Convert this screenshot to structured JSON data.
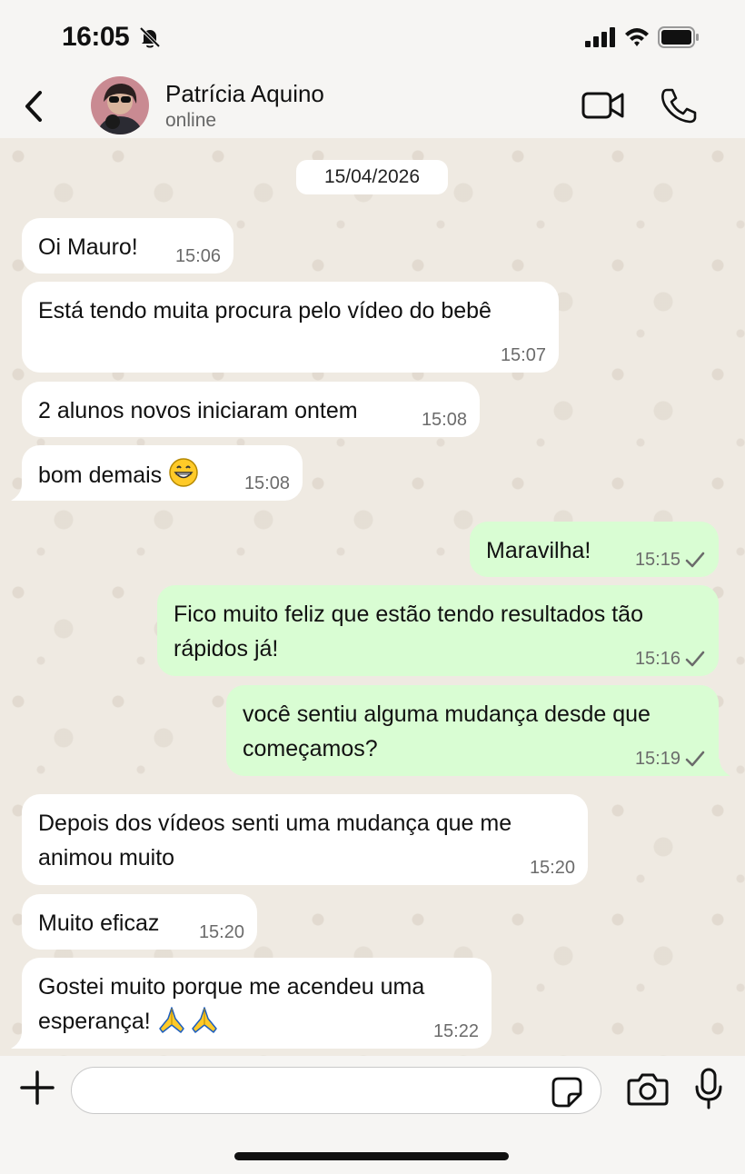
{
  "status_bar": {
    "time": "16:05",
    "icons": [
      "bell-slash-icon",
      "signal-icon",
      "wifi-icon",
      "battery-icon"
    ]
  },
  "header": {
    "back_icon": "chevron-left-icon",
    "contact_name": "Patrícia Aquino",
    "contact_status": "online",
    "actions": [
      "video-call-icon",
      "phone-icon"
    ]
  },
  "chat": {
    "date": "15/04/2026",
    "messages": [
      {
        "direction": "in",
        "text": "Oi Mauro!",
        "time": "15:06"
      },
      {
        "direction": "in",
        "text": "Está tendo muita procura pelo vídeo do bebê",
        "time": "15:07"
      },
      {
        "direction": "in",
        "text": "2 alunos novos iniciaram ontem",
        "time": "15:08"
      },
      {
        "direction": "in",
        "text": "bom demais",
        "emoji": "😁",
        "time": "15:08"
      },
      {
        "direction": "out",
        "text": "Maravilha!",
        "time": "15:15",
        "status": "sent"
      },
      {
        "direction": "out",
        "line1": "Fico muito feliz que estão tendo resultados tão",
        "line2": "rápidos já!",
        "time": "15:16",
        "status": "sent"
      },
      {
        "direction": "out",
        "line1": "você sentiu alguma mudança desde que",
        "line2": "começamos?",
        "time": "15:19",
        "status": "sent"
      },
      {
        "direction": "in",
        "line1": "Depois dos vídeos senti uma mudança que me",
        "line2": "animou muito",
        "time": "15:20"
      },
      {
        "direction": "in",
        "text": "Muito eficaz",
        "time": "15:20"
      },
      {
        "direction": "in",
        "line1": "Gostei muito porque me acendeu uma",
        "line2": "esperança!",
        "emoji": "🙏🙏",
        "time": "15:22"
      }
    ]
  },
  "input_bar": {
    "value": "",
    "placeholder": "",
    "icons": [
      "plus-icon",
      "sticker-icon",
      "camera-icon",
      "microphone-icon"
    ]
  },
  "colors": {
    "incoming_bubble": "#ffffff",
    "outgoing_bubble": "#d9fdd3",
    "chat_background": "#efeae2",
    "header_background": "#f6f5f3",
    "timestamp": "#6b6b6b"
  }
}
